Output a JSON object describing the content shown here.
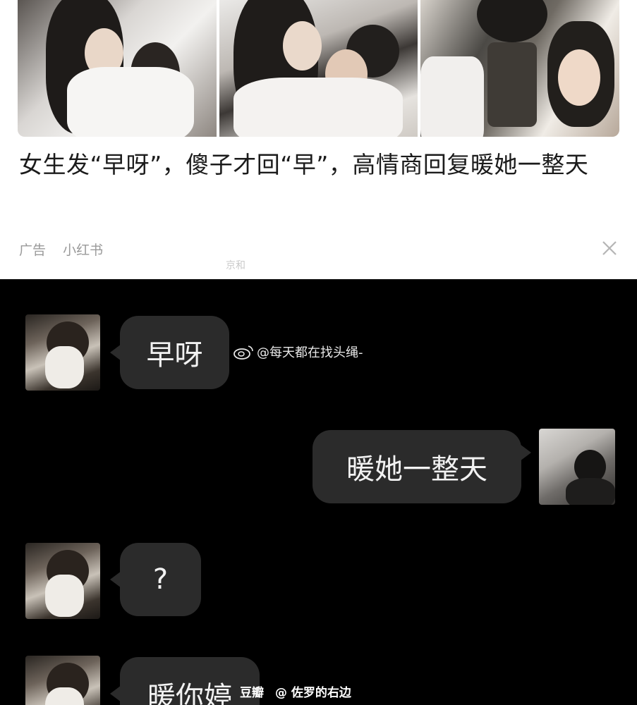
{
  "ad": {
    "title": "女生发“早呀”，傻子才回“早”，高情商回复暖她一整天",
    "label": "广告",
    "source": "小红书",
    "stamp": "京和"
  },
  "chat": {
    "messages": [
      {
        "side": "left",
        "text": "早呀"
      },
      {
        "side": "right",
        "text": "暖她一整天"
      },
      {
        "side": "left",
        "text": "?"
      },
      {
        "side": "left",
        "text": "暖你婷"
      }
    ],
    "weibo_watermark": "@每天都在找头绳-",
    "bottom_watermark_1": "豆瓣",
    "bottom_watermark_2": "@ 佐罗的右边"
  },
  "icons": {
    "close": "close-icon",
    "weibo": "weibo-logo-icon"
  }
}
